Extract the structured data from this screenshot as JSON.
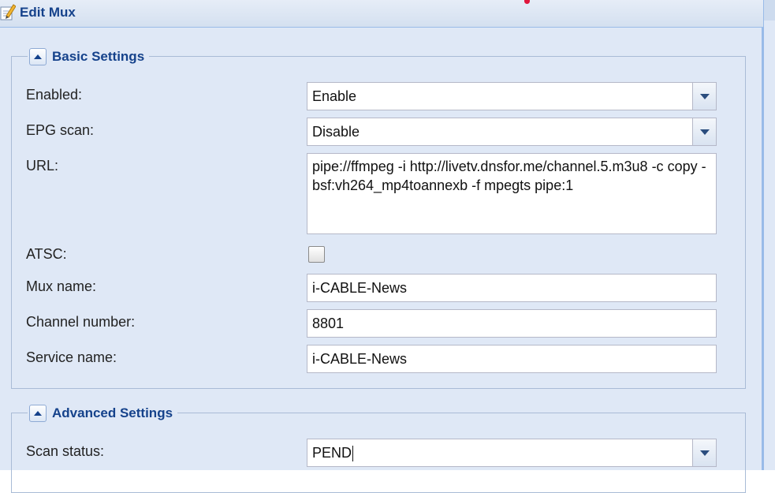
{
  "window": {
    "title": "Edit Mux",
    "icon": "edit-pencil-icon"
  },
  "basic_settings": {
    "legend": "Basic Settings",
    "enabled": {
      "label": "Enabled:",
      "value": "Enable"
    },
    "epg_scan": {
      "label": "EPG scan:",
      "value": "Disable"
    },
    "url": {
      "label": "URL:",
      "value": "pipe://ffmpeg -i http://livetv.dnsfor.me/channel.5.m3u8 -c copy -bsf:vh264_mp4toannexb -f mpegts pipe:1"
    },
    "atsc": {
      "label": "ATSC:",
      "checked": false
    },
    "mux_name": {
      "label": "Mux name:",
      "value": "i-CABLE-News"
    },
    "channel_number": {
      "label": "Channel number:",
      "value": "8801"
    },
    "service_name": {
      "label": "Service name:",
      "value": "i-CABLE-News"
    }
  },
  "advanced_settings": {
    "legend": "Advanced Settings",
    "scan_status": {
      "label": "Scan status:",
      "value": "PEND"
    }
  },
  "colors": {
    "accent": "#15428b",
    "panel_bg": "#dfe8f6",
    "border": "#99bbe8"
  }
}
